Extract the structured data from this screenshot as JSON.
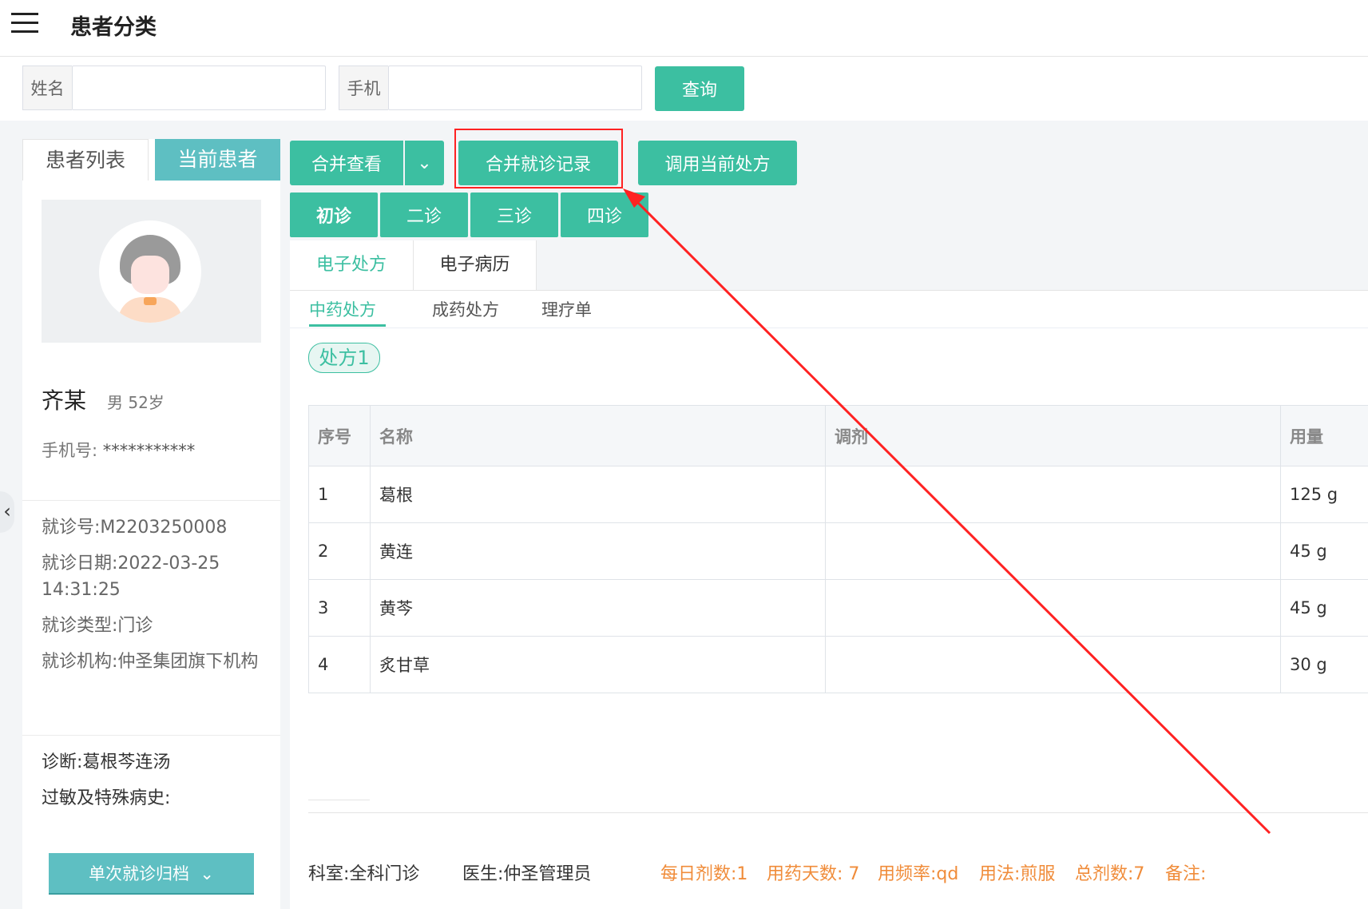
{
  "header": {
    "title": "患者分类"
  },
  "search": {
    "name_label": "姓名",
    "name_value": "",
    "phone_label": "手机",
    "phone_value": "",
    "query_label": "查询"
  },
  "sidebar": {
    "tabs": [
      "患者列表",
      "当前患者"
    ],
    "patient": {
      "name": "齐某",
      "meta": "男 52岁",
      "phone_label": "手机号:",
      "phone_value": "***********"
    },
    "visit": {
      "number": "就诊号:M2203250008",
      "date": "就诊日期:2022-03-25 14:31:25",
      "type": "就诊类型:门诊",
      "org": "就诊机构:仲圣集团旗下机构"
    },
    "diagnosis": "诊断:葛根芩连汤",
    "allergy": "过敏及特殊病史:",
    "archive_label": "单次就诊归档",
    "collapse_icon": "chevron-left-icon"
  },
  "toolbar": {
    "merge_view": "合并查看",
    "merge_record": "合并就诊记录",
    "use_current_rx": "调用当前处方"
  },
  "visits": [
    "初诊",
    "二诊",
    "三诊",
    "四诊"
  ],
  "record_tabs": [
    "电子处方",
    "电子病历"
  ],
  "rx_tabs": [
    "中药处方",
    "成药处方",
    "理疗单"
  ],
  "rx_chip": "处方1",
  "table": {
    "headers": [
      "序号",
      "名称",
      "调剂",
      "用量"
    ],
    "rows": [
      [
        "1",
        "葛根",
        "",
        "125 g"
      ],
      [
        "2",
        "黄连",
        "",
        "45 g"
      ],
      [
        "3",
        "黄芩",
        "",
        "45 g"
      ],
      [
        "4",
        "炙甘草",
        "",
        "30 g"
      ]
    ]
  },
  "footer": {
    "dept": "科室:全科门诊",
    "doctor": "医生:仲圣管理员",
    "daily_doses": "每日剂数:1",
    "days": "用药天数: 7",
    "frequency": "用频率:qd",
    "usage": "用法:煎服",
    "total": "总剂数:7",
    "remark": "备注:"
  },
  "colors": {
    "primary": "#3cbfa1",
    "teal_alt": "#5ebfc2",
    "highlight": "#ff2222",
    "footer_orange": "#f08c3a"
  }
}
